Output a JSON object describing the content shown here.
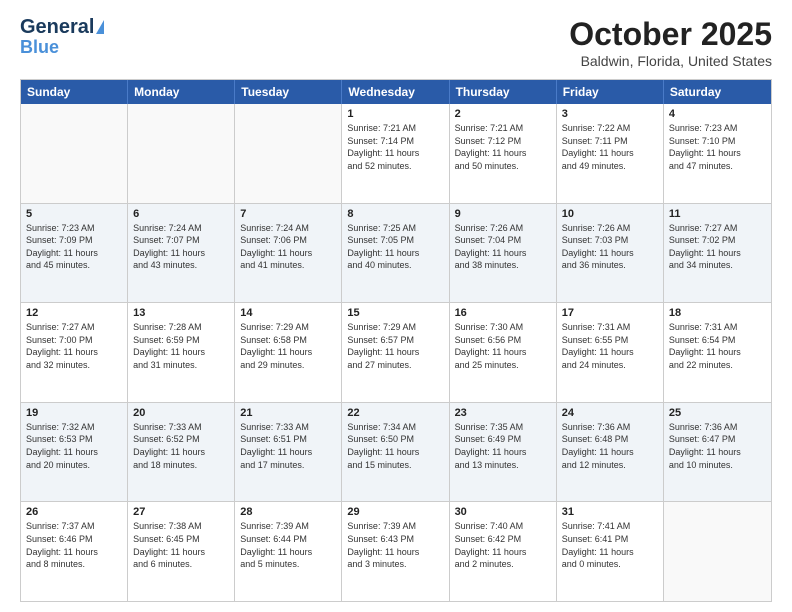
{
  "header": {
    "logo_line1": "General",
    "logo_line2": "Blue",
    "month": "October 2025",
    "location": "Baldwin, Florida, United States"
  },
  "weekdays": [
    "Sunday",
    "Monday",
    "Tuesday",
    "Wednesday",
    "Thursday",
    "Friday",
    "Saturday"
  ],
  "rows": [
    [
      {
        "day": "",
        "text": ""
      },
      {
        "day": "",
        "text": ""
      },
      {
        "day": "",
        "text": ""
      },
      {
        "day": "1",
        "text": "Sunrise: 7:21 AM\nSunset: 7:14 PM\nDaylight: 11 hours\nand 52 minutes."
      },
      {
        "day": "2",
        "text": "Sunrise: 7:21 AM\nSunset: 7:12 PM\nDaylight: 11 hours\nand 50 minutes."
      },
      {
        "day": "3",
        "text": "Sunrise: 7:22 AM\nSunset: 7:11 PM\nDaylight: 11 hours\nand 49 minutes."
      },
      {
        "day": "4",
        "text": "Sunrise: 7:23 AM\nSunset: 7:10 PM\nDaylight: 11 hours\nand 47 minutes."
      }
    ],
    [
      {
        "day": "5",
        "text": "Sunrise: 7:23 AM\nSunset: 7:09 PM\nDaylight: 11 hours\nand 45 minutes."
      },
      {
        "day": "6",
        "text": "Sunrise: 7:24 AM\nSunset: 7:07 PM\nDaylight: 11 hours\nand 43 minutes."
      },
      {
        "day": "7",
        "text": "Sunrise: 7:24 AM\nSunset: 7:06 PM\nDaylight: 11 hours\nand 41 minutes."
      },
      {
        "day": "8",
        "text": "Sunrise: 7:25 AM\nSunset: 7:05 PM\nDaylight: 11 hours\nand 40 minutes."
      },
      {
        "day": "9",
        "text": "Sunrise: 7:26 AM\nSunset: 7:04 PM\nDaylight: 11 hours\nand 38 minutes."
      },
      {
        "day": "10",
        "text": "Sunrise: 7:26 AM\nSunset: 7:03 PM\nDaylight: 11 hours\nand 36 minutes."
      },
      {
        "day": "11",
        "text": "Sunrise: 7:27 AM\nSunset: 7:02 PM\nDaylight: 11 hours\nand 34 minutes."
      }
    ],
    [
      {
        "day": "12",
        "text": "Sunrise: 7:27 AM\nSunset: 7:00 PM\nDaylight: 11 hours\nand 32 minutes."
      },
      {
        "day": "13",
        "text": "Sunrise: 7:28 AM\nSunset: 6:59 PM\nDaylight: 11 hours\nand 31 minutes."
      },
      {
        "day": "14",
        "text": "Sunrise: 7:29 AM\nSunset: 6:58 PM\nDaylight: 11 hours\nand 29 minutes."
      },
      {
        "day": "15",
        "text": "Sunrise: 7:29 AM\nSunset: 6:57 PM\nDaylight: 11 hours\nand 27 minutes."
      },
      {
        "day": "16",
        "text": "Sunrise: 7:30 AM\nSunset: 6:56 PM\nDaylight: 11 hours\nand 25 minutes."
      },
      {
        "day": "17",
        "text": "Sunrise: 7:31 AM\nSunset: 6:55 PM\nDaylight: 11 hours\nand 24 minutes."
      },
      {
        "day": "18",
        "text": "Sunrise: 7:31 AM\nSunset: 6:54 PM\nDaylight: 11 hours\nand 22 minutes."
      }
    ],
    [
      {
        "day": "19",
        "text": "Sunrise: 7:32 AM\nSunset: 6:53 PM\nDaylight: 11 hours\nand 20 minutes."
      },
      {
        "day": "20",
        "text": "Sunrise: 7:33 AM\nSunset: 6:52 PM\nDaylight: 11 hours\nand 18 minutes."
      },
      {
        "day": "21",
        "text": "Sunrise: 7:33 AM\nSunset: 6:51 PM\nDaylight: 11 hours\nand 17 minutes."
      },
      {
        "day": "22",
        "text": "Sunrise: 7:34 AM\nSunset: 6:50 PM\nDaylight: 11 hours\nand 15 minutes."
      },
      {
        "day": "23",
        "text": "Sunrise: 7:35 AM\nSunset: 6:49 PM\nDaylight: 11 hours\nand 13 minutes."
      },
      {
        "day": "24",
        "text": "Sunrise: 7:36 AM\nSunset: 6:48 PM\nDaylight: 11 hours\nand 12 minutes."
      },
      {
        "day": "25",
        "text": "Sunrise: 7:36 AM\nSunset: 6:47 PM\nDaylight: 11 hours\nand 10 minutes."
      }
    ],
    [
      {
        "day": "26",
        "text": "Sunrise: 7:37 AM\nSunset: 6:46 PM\nDaylight: 11 hours\nand 8 minutes."
      },
      {
        "day": "27",
        "text": "Sunrise: 7:38 AM\nSunset: 6:45 PM\nDaylight: 11 hours\nand 6 minutes."
      },
      {
        "day": "28",
        "text": "Sunrise: 7:39 AM\nSunset: 6:44 PM\nDaylight: 11 hours\nand 5 minutes."
      },
      {
        "day": "29",
        "text": "Sunrise: 7:39 AM\nSunset: 6:43 PM\nDaylight: 11 hours\nand 3 minutes."
      },
      {
        "day": "30",
        "text": "Sunrise: 7:40 AM\nSunset: 6:42 PM\nDaylight: 11 hours\nand 2 minutes."
      },
      {
        "day": "31",
        "text": "Sunrise: 7:41 AM\nSunset: 6:41 PM\nDaylight: 11 hours\nand 0 minutes."
      },
      {
        "day": "",
        "text": ""
      }
    ]
  ]
}
